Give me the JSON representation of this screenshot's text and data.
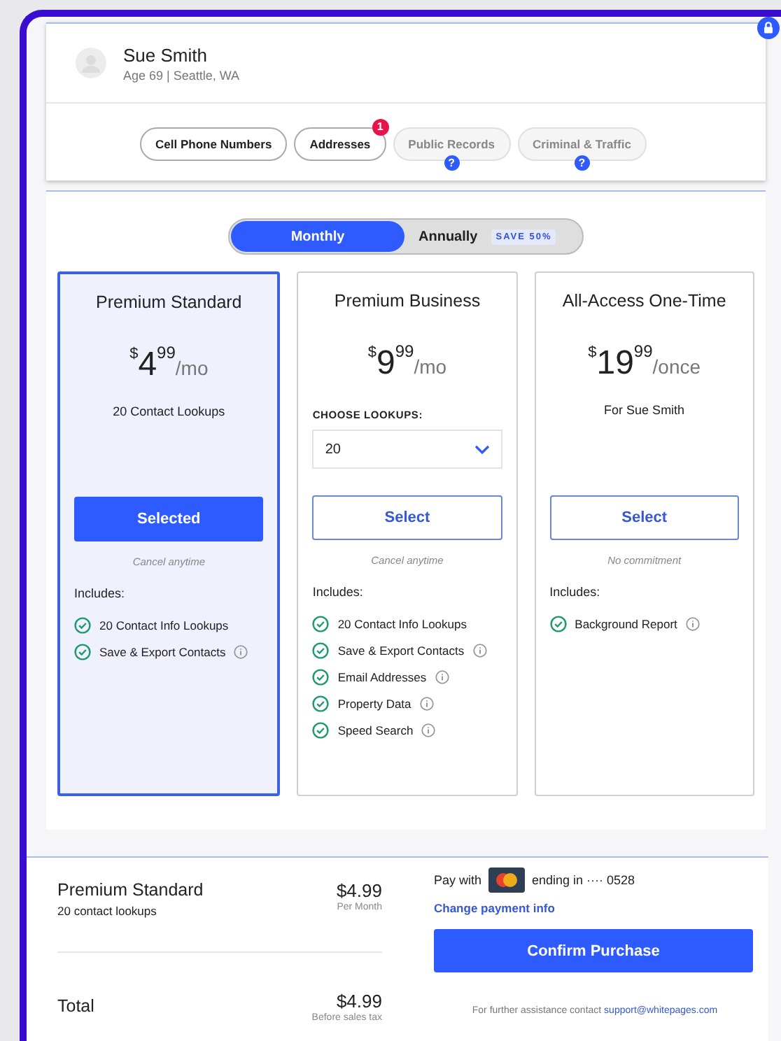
{
  "profile": {
    "name": "Sue Smith",
    "details": "Age 69 | Seattle, WA"
  },
  "tabs": [
    {
      "label": "Cell Phone Numbers",
      "disabled": false
    },
    {
      "label": "Addresses",
      "disabled": false,
      "badge": "1"
    },
    {
      "label": "Public Records",
      "disabled": true,
      "help": "?"
    },
    {
      "label": "Criminal & Traffic",
      "disabled": true,
      "help": "?"
    }
  ],
  "billing_toggle": [
    {
      "label": "Monthly",
      "selected": true
    },
    {
      "label": "Annually",
      "selected": false,
      "badge": "SAVE 50%"
    }
  ],
  "plans": [
    {
      "title": "Premium Standard",
      "selected": true,
      "currency": "$",
      "amount": "4",
      "cents": "99",
      "period": "/mo",
      "kind": "text",
      "description": "20 Contact Lookups",
      "button": "Selected",
      "note": "Cancel anytime",
      "includes_label": "Includes:",
      "features": [
        {
          "label": "20 Contact Info Lookups",
          "info": false
        },
        {
          "label": "Save & Export Contacts",
          "info": true
        }
      ]
    },
    {
      "title": "Premium Business",
      "selected": false,
      "currency": "$",
      "amount": "9",
      "cents": "99",
      "period": "/mo",
      "kind": "select",
      "select_label": "CHOOSE LOOKUPS:",
      "select_value": "20",
      "button": "Select",
      "note": "Cancel anytime",
      "includes_label": "Includes:",
      "features": [
        {
          "label": "20 Contact Info Lookups",
          "info": false
        },
        {
          "label": "Save & Export Contacts",
          "info": true
        },
        {
          "label": "Email Addresses",
          "info": true
        },
        {
          "label": "Property Data",
          "info": true
        },
        {
          "label": "Speed Search",
          "info": true
        }
      ]
    },
    {
      "title": "All-Access One-Time",
      "selected": false,
      "currency": "$",
      "amount": "19",
      "cents": "99",
      "period": "/once",
      "kind": "text",
      "description": "For Sue Smith",
      "button": "Select",
      "note": "No commitment",
      "includes_label": "Includes:",
      "features": [
        {
          "label": "Background Report",
          "info": true
        }
      ]
    }
  ],
  "summary": {
    "plan_name": "Premium Standard",
    "plan_detail": "20 contact lookups",
    "plan_price": "$4.99",
    "plan_period": "Per Month",
    "total_label": "Total",
    "total_price": "$4.99",
    "total_note": "Before sales tax"
  },
  "payment": {
    "pay_with": "Pay with",
    "card_ending": "ending in ···· 0528",
    "change_link": "Change payment info",
    "confirm_button": "Confirm Purchase",
    "help_text": "For further assistance contact",
    "help_email": "support@whitepages.com"
  }
}
